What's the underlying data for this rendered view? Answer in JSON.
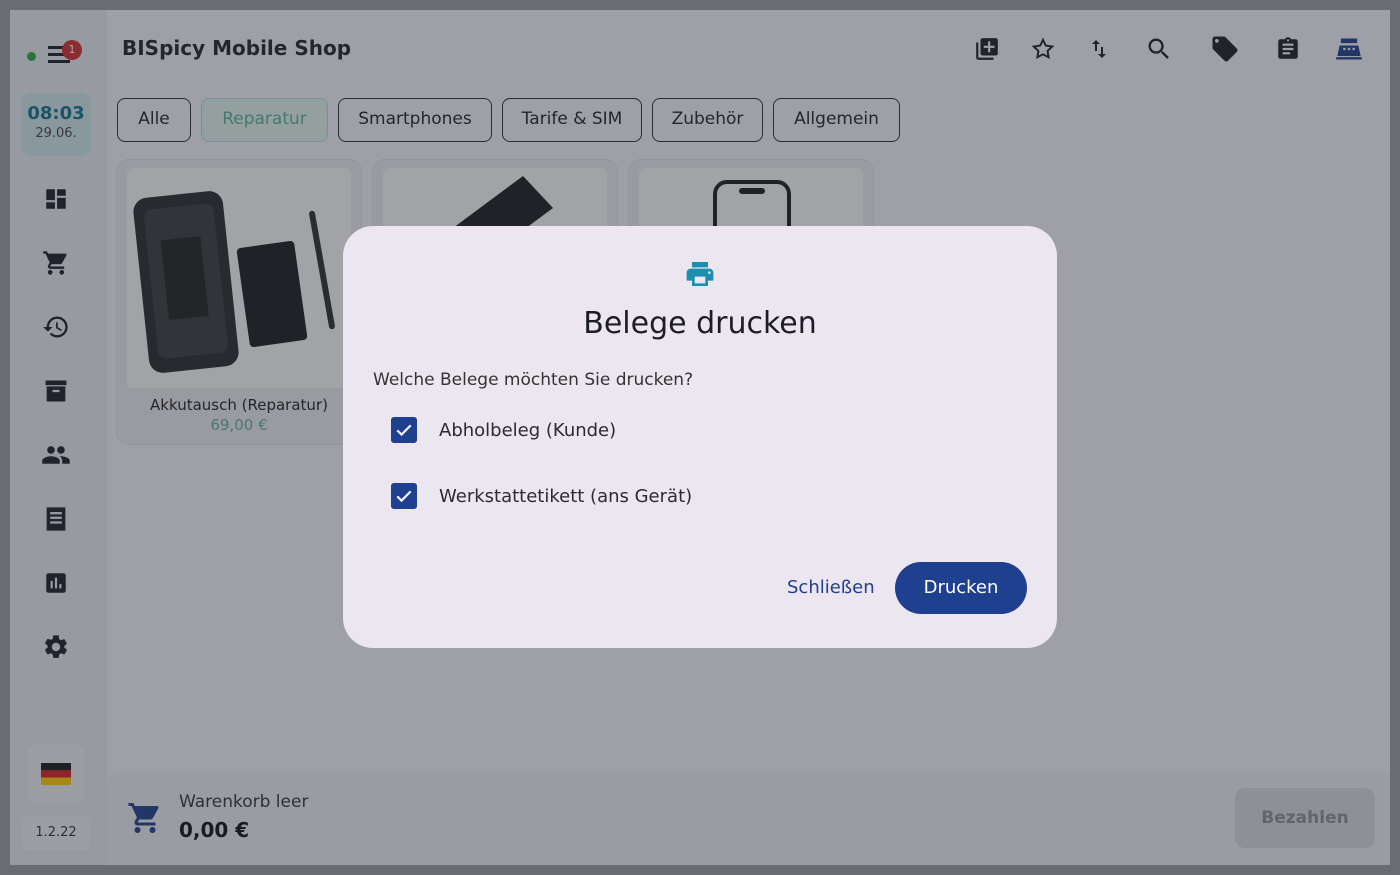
{
  "header": {
    "title": "BISpicy Mobile Shop"
  },
  "sidebar": {
    "badge_count": "1",
    "time": "08:03",
    "date": "29.06.",
    "version": "1.2.22",
    "nav_icons": [
      "dashboard-icon",
      "cart-icon",
      "history-icon",
      "archive-icon",
      "customers-icon",
      "receipts-icon",
      "stats-icon",
      "settings-icon"
    ]
  },
  "toolbar_icons": [
    "add-box-icon",
    "star-icon",
    "sort-icon",
    "search-icon",
    "tag-icon",
    "clipboard-icon",
    "cash-register-icon"
  ],
  "tabs": [
    {
      "label": "Alle"
    },
    {
      "label": "Reparatur",
      "active": true
    },
    {
      "label": "Smartphones"
    },
    {
      "label": "Tarife & SIM"
    },
    {
      "label": "Zubehör"
    },
    {
      "label": "Allgemein"
    }
  ],
  "products": [
    {
      "name": "Akkutausch (Reparatur)",
      "price": "69,00 €"
    },
    {
      "name": "",
      "price": ""
    },
    {
      "name": "",
      "price": ""
    }
  ],
  "cart": {
    "label": "Warenkorb leer",
    "total": "0,00 €",
    "pay_label": "Bezahlen"
  },
  "dialog": {
    "title": "Belege drucken",
    "question": "Welche Belege möchten Sie drucken?",
    "options": [
      {
        "label": "Abholbeleg (Kunde)",
        "checked": true
      },
      {
        "label": "Werkstattetikett (ans Gerät)",
        "checked": true
      }
    ],
    "close_label": "Schließen",
    "print_label": "Drucken"
  },
  "colors": {
    "primary": "#1f3f8f",
    "accent": "#13708a",
    "active_tab": "#5cb09d"
  }
}
